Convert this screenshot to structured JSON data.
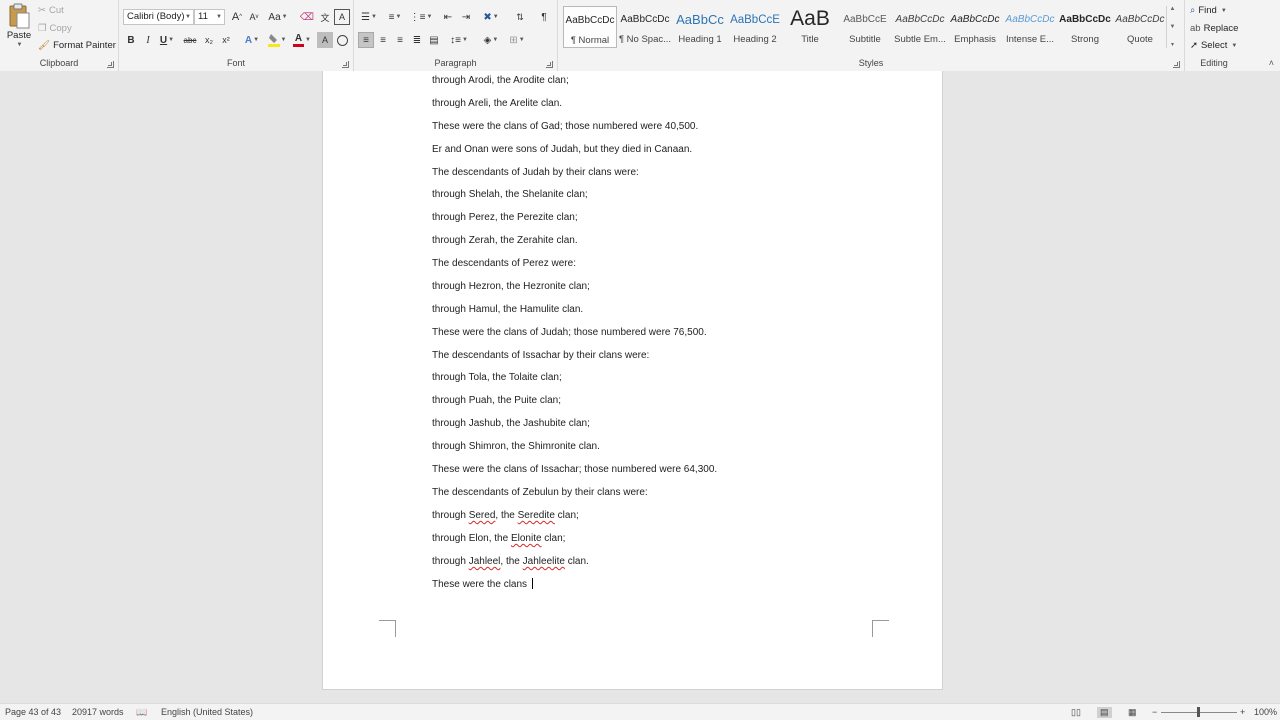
{
  "ribbon": {
    "clipboard": {
      "paste": "Paste",
      "cut": "Cut",
      "copy": "Copy",
      "format_painter": "Format Painter",
      "label": "Clipboard"
    },
    "font": {
      "family": "Calibri (Body)",
      "size": "11",
      "label": "Font",
      "bold": "B",
      "italic": "I",
      "underline": "U",
      "strike": "abc",
      "subscript": "x₂",
      "superscript": "x²",
      "grow": "A",
      "shrink": "A",
      "change_case": "Aa",
      "font_color_letter": "A",
      "text_effects_letter": "A",
      "shading_letter": "A"
    },
    "paragraph": {
      "label": "Paragraph",
      "pilcrow": "¶"
    },
    "styles": {
      "label": "Styles",
      "items": [
        {
          "preview": "AaBbCcDc",
          "name": "¶ Normal"
        },
        {
          "preview": "AaBbCcDc",
          "name": "¶ No Spac..."
        },
        {
          "preview": "AaBbCc",
          "name": "Heading 1"
        },
        {
          "preview": "AaBbCcE",
          "name": "Heading 2"
        },
        {
          "preview": "AaB",
          "name": "Title"
        },
        {
          "preview": "AaBbCcE",
          "name": "Subtitle"
        },
        {
          "preview": "AaBbCcDc",
          "name": "Subtle Em..."
        },
        {
          "preview": "AaBbCcDc",
          "name": "Emphasis"
        },
        {
          "preview": "AaBbCcDc",
          "name": "Intense E..."
        },
        {
          "preview": "AaBbCcDc",
          "name": "Strong"
        },
        {
          "preview": "AaBbCcDc",
          "name": "Quote"
        }
      ]
    },
    "editing": {
      "label": "Editing",
      "find": "Find",
      "replace": "Replace",
      "select": "Select"
    }
  },
  "document": {
    "paragraphs": [
      {
        "text": "through Arodi, the Arodite clan;"
      },
      {
        "text": "through Areli, the Arelite clan."
      },
      {
        "text": "These were the clans of Gad; those numbered were 40,500."
      },
      {
        "text": "Er and Onan were sons of Judah, but they died in Canaan."
      },
      {
        "text": "The descendants of Judah by their clans were:"
      },
      {
        "text": "through Shelah, the Shelanite clan;"
      },
      {
        "text": "through Perez, the Perezite clan;"
      },
      {
        "text": "through Zerah, the Zerahite clan."
      },
      {
        "text": "The descendants of Perez were:"
      },
      {
        "text": "through Hezron, the Hezronite clan;"
      },
      {
        "text": "through Hamul, the Hamulite clan."
      },
      {
        "text": "These were the clans of Judah; those numbered were 76,500."
      },
      {
        "text": "The descendants of Issachar by their clans were:"
      },
      {
        "text": "through Tola, the Tolaite clan;"
      },
      {
        "text": "through Puah, the Puite clan;"
      },
      {
        "text": "through Jashub, the Jashubite clan;"
      },
      {
        "text": "through Shimron, the Shimronite clan."
      },
      {
        "text": "These were the clans of Issachar; those numbered were 64,300."
      },
      {
        "text": "The descendants of Zebulun by their clans were:"
      },
      {
        "parts": [
          "through ",
          "Sered",
          ", the ",
          "Seredite",
          " clan;"
        ]
      },
      {
        "parts": [
          "through Elon, the ",
          "Elonite",
          " clan;"
        ]
      },
      {
        "parts": [
          "through ",
          "Jahleel",
          ", the ",
          "Jahleelite",
          " clan."
        ]
      },
      {
        "text": "These were the clans "
      }
    ]
  },
  "statusbar": {
    "page": "Page 43 of 43",
    "words": "20917 words",
    "language": "English (United States)",
    "zoom": "100%",
    "zoom_minus": "−",
    "zoom_plus": "+"
  },
  "colors": {
    "accent": "#2b579a",
    "font_color": "#d0021b",
    "highlight": "#f5e71a",
    "spell_underline": "#d42a2a"
  }
}
